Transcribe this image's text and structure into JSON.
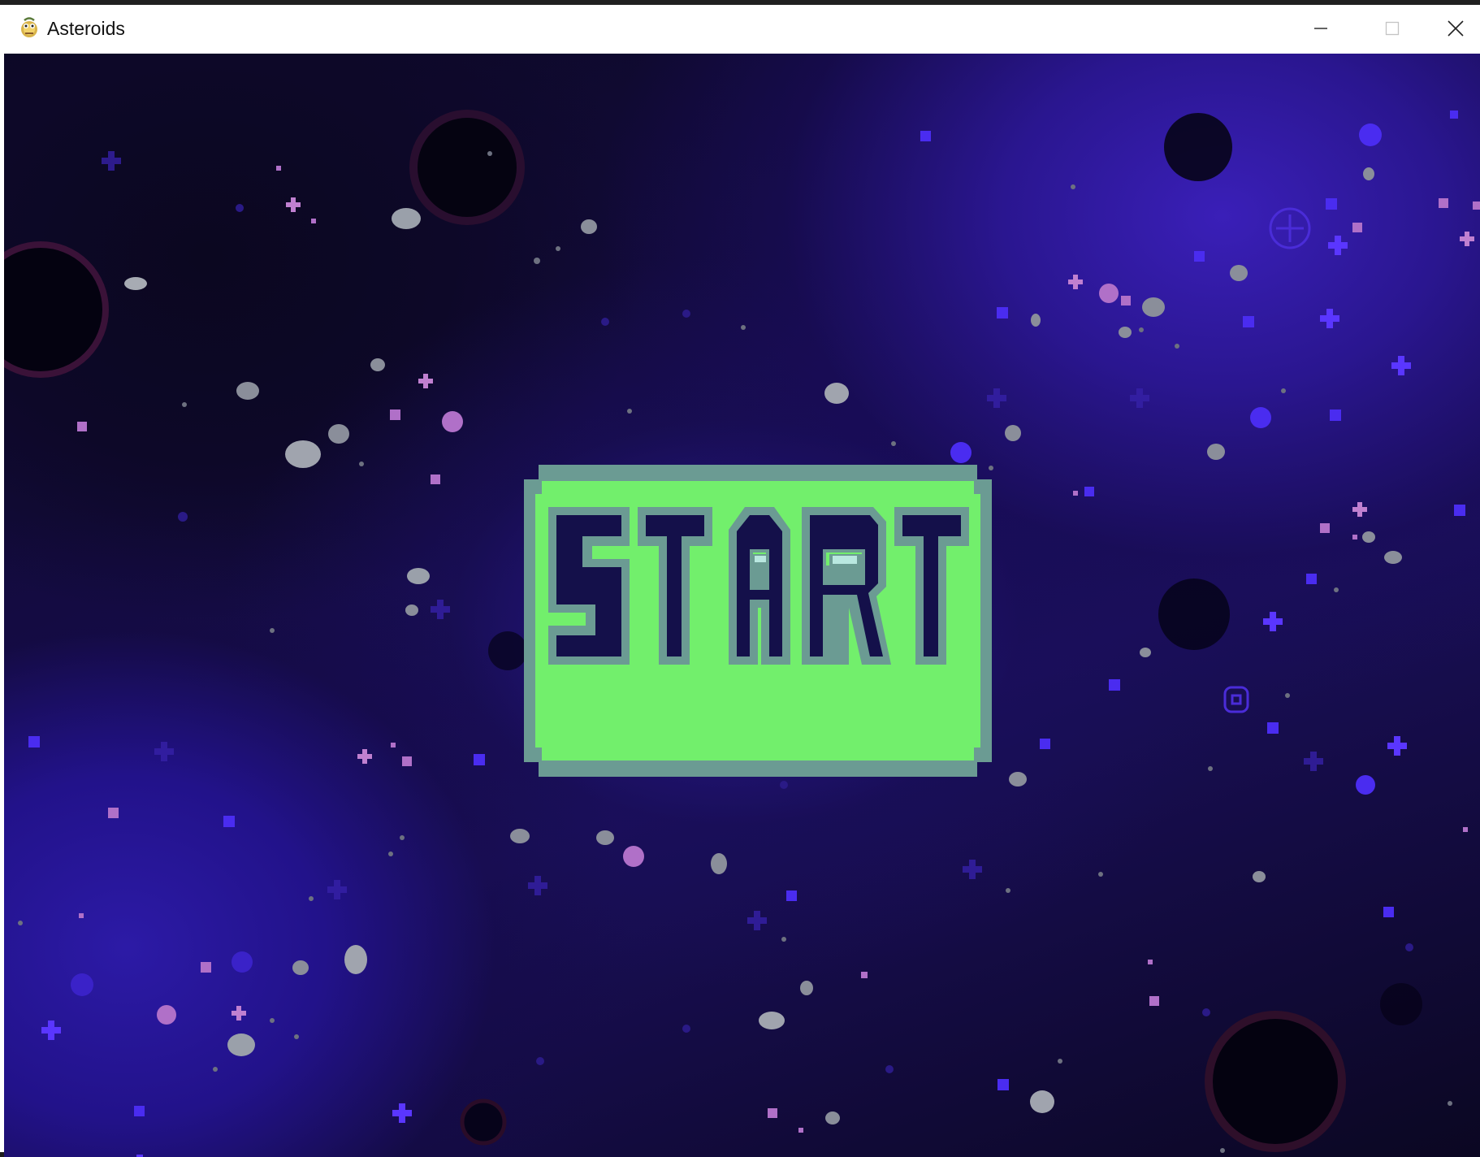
{
  "window": {
    "title": "Asteroids",
    "icon": "pygame-snake-icon",
    "controls": {
      "minimize": "minimize-icon",
      "maximize": "maximize-icon",
      "close": "close-icon"
    }
  },
  "game": {
    "screen": "start-menu",
    "start_button": {
      "label": "START",
      "fill_color": "#72ef6c",
      "border_color": "#6a9a92",
      "letter_color": "#14104a"
    },
    "background": {
      "theme": "deep-space nebula",
      "colors": [
        "#0c0824",
        "#1a0f5a",
        "#3a1fb8",
        "#8c5ea8"
      ]
    }
  }
}
